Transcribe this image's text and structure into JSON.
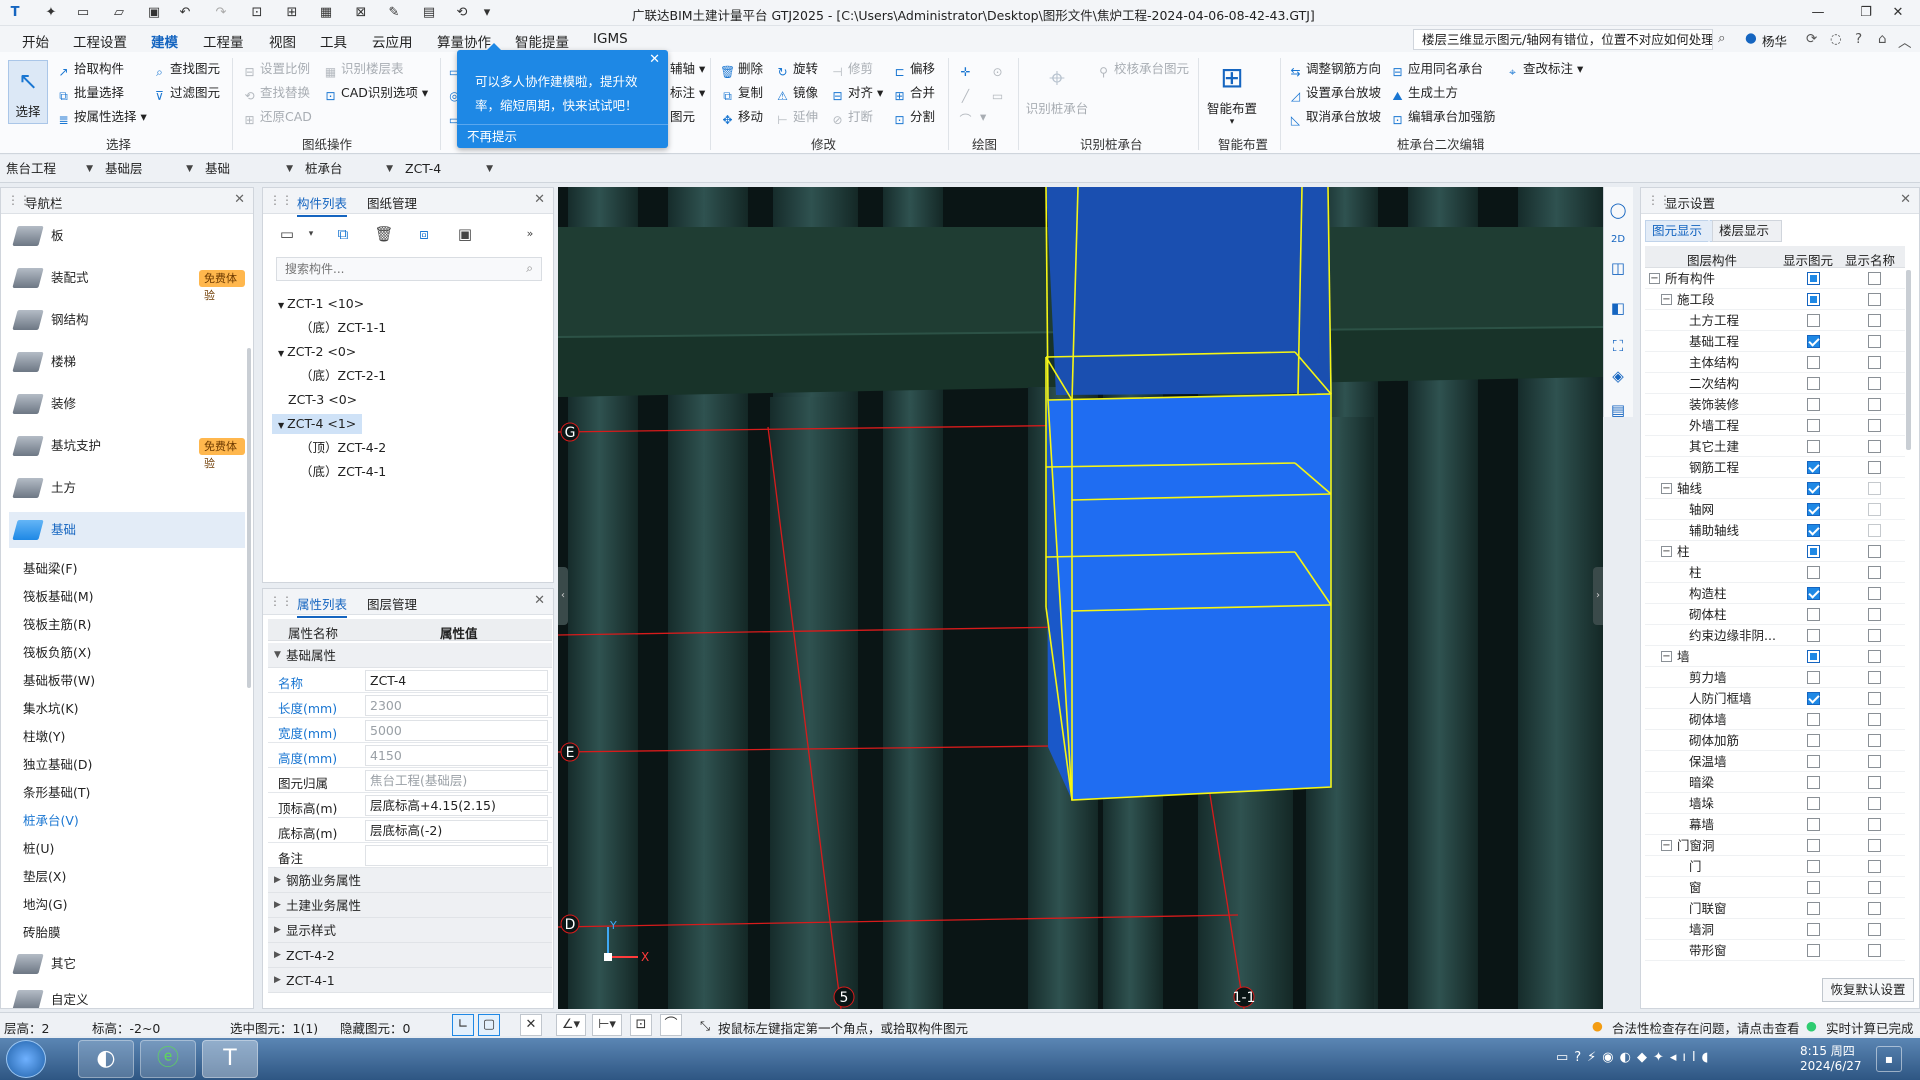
{
  "titlebar": {
    "title": "广联达BIM土建计量平台 GTJ2025 - [C:\\Users\\Administrator\\Desktop\\图形文件\\焦炉工程-2024-04-06-08-42-43.GTJ]",
    "minimize": "—",
    "restore": "❐",
    "close": "✕"
  },
  "menubar": {
    "items": [
      "开始",
      "工程设置",
      "建模",
      "工程量",
      "视图",
      "工具",
      "云应用",
      "算量协作",
      "智能提量",
      "IGMS"
    ],
    "active": "建模",
    "help_question": "楼层三维显示图元/轴网有错位，位置不对应如何处理？",
    "user": "杨华"
  },
  "ribbon": {
    "select_group": {
      "big": "选择",
      "pick": "拾取构件",
      "batch": "批量选择",
      "by_attr": "按属性选择",
      "find": "查找图元",
      "filter": "过滤图元",
      "label": "选择"
    },
    "drawing_group": {
      "set_scale": "设置比例",
      "identify_floor_table": "识别楼层表",
      "find_replace": "查找替换",
      "cad_options": "CAD识别选项",
      "restore_cad": "还原CAD",
      "label": "图纸操作"
    },
    "collab_snippets": {
      "aux": "辅轴",
      "note": "标注",
      "elem": "图元"
    },
    "modify_group": {
      "delete": "删除",
      "rotate": "旋转",
      "trim": "修剪",
      "offset": "偏移",
      "copy": "复制",
      "mirror": "镜像",
      "align": "对齐",
      "merge": "合并",
      "move": "移动",
      "extend": "延伸",
      "break": "打断",
      "split": "分割",
      "label": "修改"
    },
    "draw_group": {
      "label": "绘图"
    },
    "identify_cap_group": {
      "identify": "识别桩承台",
      "verify": "校核承台图元",
      "label": "识别桩承台"
    },
    "smart_group": {
      "smart_layout": "智能布置",
      "label": "智能布置"
    },
    "secondary_group": {
      "adjust_rebar": "调整钢筋方向",
      "apply_same": "应用同名承台",
      "view_dims": "查改标注",
      "set_slope": "设置承台放坡",
      "gen_earth": "生成土方",
      "cancel_slope": "取消承台放坡",
      "edit_reinf": "编辑承台加强筋",
      "label": "桩承台二次编辑"
    }
  },
  "popup": {
    "text": "可以多人协作建模啦，提升效率，缩短周期，快来试试吧！",
    "dismiss": "不再提示",
    "close": "✕"
  },
  "selectors": {
    "project": "焦台工程",
    "floor": "基础层",
    "category": "基础",
    "type": "桩承台",
    "component": "ZCT-4"
  },
  "nav": {
    "title": "导航栏",
    "items": [
      {
        "label": "板",
        "badge": ""
      },
      {
        "label": "装配式",
        "badge": "免费体验"
      },
      {
        "label": "钢结构",
        "badge": ""
      },
      {
        "label": "楼梯",
        "badge": ""
      },
      {
        "label": "装修",
        "badge": ""
      },
      {
        "label": "基坑支护",
        "badge": "免费体验"
      },
      {
        "label": "土方",
        "badge": ""
      },
      {
        "label": "基础",
        "badge": ""
      }
    ],
    "subitems": [
      "基础梁(F)",
      "筏板基础(M)",
      "筏板主筋(R)",
      "筏板负筋(X)",
      "基础板带(W)",
      "集水坑(K)",
      "柱墩(Y)",
      "独立基础(D)",
      "条形基础(T)",
      "桩承台(V)",
      "桩(U)",
      "垫层(X)",
      "地沟(G)",
      "砖胎膜"
    ],
    "active_sub": "桩承台(V)",
    "more": [
      "其它",
      "自定义"
    ]
  },
  "component_list": {
    "tab1": "构件列表",
    "tab2": "图纸管理",
    "search_placeholder": "搜索构件...",
    "tree": [
      "ZCT-1 <10>",
      "（底）ZCT-1-1",
      "ZCT-2 <0>",
      "（底）ZCT-2-1",
      "ZCT-3 <0>",
      "ZCT-4 <1>",
      "（顶）ZCT-4-2",
      "（底）ZCT-4-1"
    ],
    "selected": "ZCT-4 <1>"
  },
  "properties": {
    "tab1": "属性列表",
    "tab2": "图层管理",
    "col_name": "属性名称",
    "col_value": "属性值",
    "group_basic": "基础属性",
    "rows": [
      {
        "k": "名称",
        "v": "ZCT-4"
      },
      {
        "k": "长度(mm)",
        "v": "2300"
      },
      {
        "k": "宽度(mm)",
        "v": "5000"
      },
      {
        "k": "高度(mm)",
        "v": "4150"
      },
      {
        "k": "图元归属",
        "v": "焦台工程(基础层)"
      },
      {
        "k": "顶标高(m)",
        "v": "层底标高+4.15(2.15)"
      },
      {
        "k": "底标高(m)",
        "v": "层底标高(-2)"
      },
      {
        "k": "备注",
        "v": ""
      }
    ],
    "groups": [
      "钢筋业务属性",
      "土建业务属性",
      "显示样式",
      "ZCT-4-2",
      "ZCT-4-1"
    ]
  },
  "viewport": {
    "axis_labels": [
      "G",
      "E",
      "D",
      "5",
      "1-1"
    ],
    "axis_x": "X",
    "axis_y": "Y"
  },
  "display_settings": {
    "title": "显示设置",
    "tab1": "图元显示",
    "tab2": "楼层显示",
    "col1": "图层构件",
    "col2": "显示图元",
    "col3": "显示名称",
    "rows": [
      {
        "label": "所有构件",
        "level": 0,
        "exp": true,
        "s": "part",
        "n": "off"
      },
      {
        "label": "施工段",
        "level": 1,
        "exp": true,
        "s": "part",
        "n": "off"
      },
      {
        "label": "土方工程",
        "level": 2,
        "exp": false,
        "s": "off",
        "n": "off"
      },
      {
        "label": "基础工程",
        "level": 2,
        "exp": false,
        "s": "on",
        "n": "off"
      },
      {
        "label": "主体结构",
        "level": 2,
        "exp": false,
        "s": "off",
        "n": "off"
      },
      {
        "label": "二次结构",
        "level": 2,
        "exp": false,
        "s": "off",
        "n": "off"
      },
      {
        "label": "装饰装修",
        "level": 2,
        "exp": false,
        "s": "off",
        "n": "off"
      },
      {
        "label": "外墙工程",
        "level": 2,
        "exp": false,
        "s": "off",
        "n": "off"
      },
      {
        "label": "其它土建",
        "level": 2,
        "exp": false,
        "s": "off",
        "n": "off"
      },
      {
        "label": "钢筋工程",
        "level": 2,
        "exp": false,
        "s": "on",
        "n": "off"
      },
      {
        "label": "轴线",
        "level": 1,
        "exp": true,
        "s": "on",
        "n": "dim"
      },
      {
        "label": "轴网",
        "level": 2,
        "exp": false,
        "s": "on",
        "n": "dim"
      },
      {
        "label": "辅助轴线",
        "level": 2,
        "exp": false,
        "s": "on",
        "n": "dim"
      },
      {
        "label": "柱",
        "level": 1,
        "exp": true,
        "s": "part",
        "n": "off"
      },
      {
        "label": "柱",
        "level": 2,
        "exp": false,
        "s": "off",
        "n": "off"
      },
      {
        "label": "构造柱",
        "level": 2,
        "exp": false,
        "s": "on",
        "n": "off"
      },
      {
        "label": "砌体柱",
        "level": 2,
        "exp": false,
        "s": "off",
        "n": "off"
      },
      {
        "label": "约束边缘非阴...",
        "level": 2,
        "exp": false,
        "s": "off",
        "n": "off"
      },
      {
        "label": "墙",
        "level": 1,
        "exp": true,
        "s": "part",
        "n": "off"
      },
      {
        "label": "剪力墙",
        "level": 2,
        "exp": false,
        "s": "off",
        "n": "off"
      },
      {
        "label": "人防门框墙",
        "level": 2,
        "exp": false,
        "s": "on",
        "n": "off"
      },
      {
        "label": "砌体墙",
        "level": 2,
        "exp": false,
        "s": "off",
        "n": "off"
      },
      {
        "label": "砌体加筋",
        "level": 2,
        "exp": false,
        "s": "off",
        "n": "off"
      },
      {
        "label": "保温墙",
        "level": 2,
        "exp": false,
        "s": "off",
        "n": "off"
      },
      {
        "label": "暗梁",
        "level": 2,
        "exp": false,
        "s": "off",
        "n": "off"
      },
      {
        "label": "墙垛",
        "level": 2,
        "exp": false,
        "s": "off",
        "n": "off"
      },
      {
        "label": "幕墙",
        "level": 2,
        "exp": false,
        "s": "off",
        "n": "off"
      },
      {
        "label": "门窗洞",
        "level": 1,
        "exp": true,
        "s": "off",
        "n": "off"
      },
      {
        "label": "门",
        "level": 2,
        "exp": false,
        "s": "off",
        "n": "off"
      },
      {
        "label": "窗",
        "level": 2,
        "exp": false,
        "s": "off",
        "n": "off"
      },
      {
        "label": "门联窗",
        "level": 2,
        "exp": false,
        "s": "off",
        "n": "off"
      },
      {
        "label": "墙洞",
        "level": 2,
        "exp": false,
        "s": "off",
        "n": "off"
      },
      {
        "label": "带形窗",
        "level": 2,
        "exp": false,
        "s": "off",
        "n": "off"
      }
    ],
    "restore_btn": "恢复默认设置"
  },
  "statusbar": {
    "floor_height": "层高：2",
    "elevation": "标高：-2~0",
    "selected": "选中图元：1(1)",
    "hidden": "隐藏图元：0",
    "hint": "按鼠标左键指定第一个角点，或拾取构件图元",
    "warning": "合法性检查存在问题，请点击查看",
    "calc": "实时计算已完成"
  },
  "taskbar": {
    "time": "8:15 周四",
    "date": "2024/6/27"
  },
  "colors": {
    "accent": "#1e88e5",
    "viewport_bg": "#0d1c1c",
    "column": "#2b4a48",
    "cap_blue": "#1f6df2",
    "cap_edge": "#f5f514",
    "grid_red": "#d81b1b",
    "warning": "#f39c12",
    "ok": "#2ecc71"
  }
}
